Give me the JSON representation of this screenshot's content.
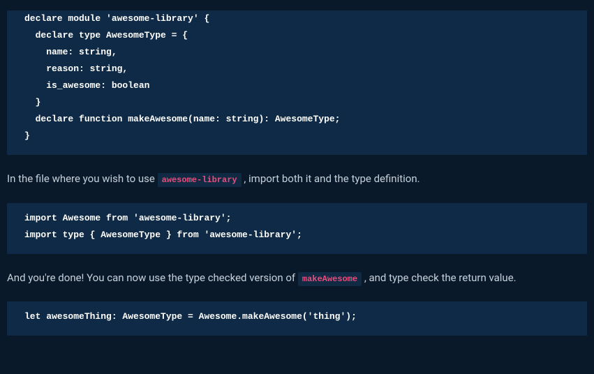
{
  "codeBlock1": "declare module 'awesome-library' {\n  declare type AwesomeType = {\n    name: string,\n    reason: string,\n    is_awesome: boolean\n  }\n  declare function makeAwesome(name: string): AwesomeType;\n}",
  "paragraph1": {
    "before": "In the file where you wish to use ",
    "inline": "awesome-library",
    "after": " , import both it and the type definition."
  },
  "codeBlock2": "import Awesome from 'awesome-library';\nimport type { AwesomeType } from 'awesome-library';",
  "paragraph2": {
    "before": "And you're done! You can now use the type checked version of ",
    "inline": "makeAwesome",
    "after": " , and type check the return value."
  },
  "codeBlock3": "let awesomeThing: AwesomeType = Awesome.makeAwesome('thing');"
}
